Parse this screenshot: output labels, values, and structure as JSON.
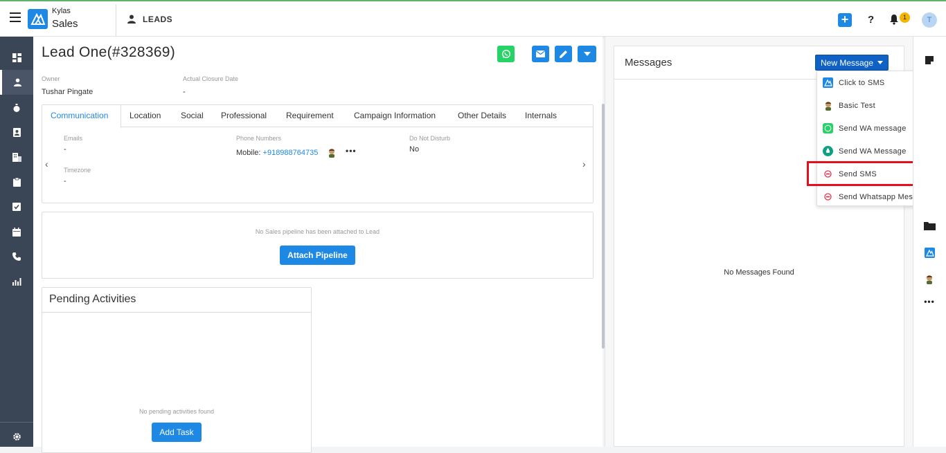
{
  "brand": {
    "line1": "Kylas",
    "line2": "Sales"
  },
  "breadcrumb": {
    "label": "LEADS"
  },
  "header": {
    "help": "?",
    "notification_count": "1",
    "user_initial": "T"
  },
  "lead": {
    "title": "Lead One(#328369)",
    "owner_label": "Owner",
    "owner_value": "Tushar Pingate",
    "closure_label": "Actual Closure Date",
    "closure_value": "-"
  },
  "tabs": [
    "Communication",
    "Location",
    "Social",
    "Professional",
    "Requirement",
    "Campaign Information",
    "Other Details",
    "Internals"
  ],
  "communication": {
    "emails_label": "Emails",
    "emails_value": "-",
    "phones_label": "Phone Numbers",
    "phone_prefix": "Mobile:",
    "phone_value": "+918988764735",
    "dnd_label": "Do Not Disturb",
    "dnd_value": "No",
    "timezone_label": "Timezone",
    "timezone_value": "-"
  },
  "pipeline": {
    "note": "No Sales pipeline has been attached to Lead",
    "button": "Attach Pipeline"
  },
  "activities": {
    "title": "Pending Activities",
    "note": "No pending activities found",
    "button": "Add Task"
  },
  "messages": {
    "title": "Messages",
    "new_button": "New Message",
    "empty": "No Messages Found",
    "menu": [
      {
        "label": "Click to SMS",
        "icon": "kylas-logo-icon"
      },
      {
        "label": "Basic Test",
        "icon": "app-avatar-icon"
      },
      {
        "label": "Send WA message",
        "icon": "whatsapp-icon"
      },
      {
        "label": "Send WA Message",
        "icon": "teal-app-icon"
      },
      {
        "label": "Send SMS",
        "icon": "red-circle-icon"
      },
      {
        "label": "Send Whatsapp Message",
        "icon": "red-circle-icon"
      }
    ]
  },
  "colors": {
    "accent": "#1e88e5",
    "sidebar": "#3a4556",
    "whatsapp": "#25d366",
    "highlight": "#e3101c",
    "new_message": "#0f62c4"
  }
}
